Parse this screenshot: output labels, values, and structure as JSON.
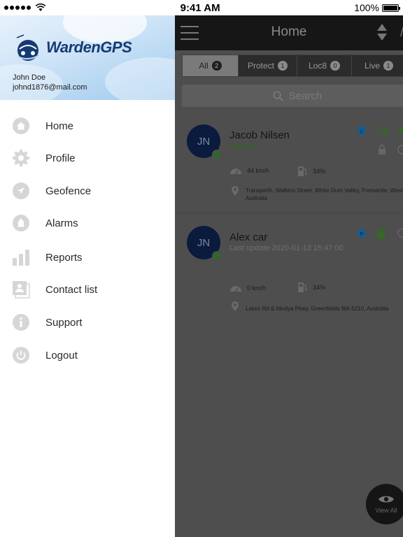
{
  "status_bar": {
    "time": "9:41 AM",
    "battery": "100%"
  },
  "drawer": {
    "brand": "WardenGPS",
    "user_name": "John Doe",
    "user_email": "johnd1876@mail.com",
    "menu": [
      {
        "label": "Home",
        "icon": "home-icon"
      },
      {
        "label": "Profile",
        "icon": "gear-icon"
      },
      {
        "label": "Geofence",
        "icon": "navigation-icon"
      },
      {
        "label": "Alarms",
        "icon": "bell-icon"
      },
      {
        "label": "Reports",
        "icon": "bar-chart-icon"
      },
      {
        "label": "Contact list",
        "icon": "contacts-icon"
      },
      {
        "label": "Support",
        "icon": "info-icon"
      },
      {
        "label": "Logout",
        "icon": "power-icon"
      }
    ]
  },
  "header": {
    "title": "Home"
  },
  "tabs": [
    {
      "label": "All",
      "count": "2"
    },
    {
      "label": "Protect",
      "count": "1"
    },
    {
      "label": "Loc8",
      "count": "0"
    },
    {
      "label": "Live",
      "count": "1"
    }
  ],
  "search": {
    "placeholder": "Search"
  },
  "vehicles": [
    {
      "initials": "JN",
      "name": "Jacob Nilsen",
      "status": "moving",
      "badge": "L",
      "speed": "44 km/h",
      "fuel": "34%",
      "address": "Transperth, Watkins Street, White Gum Valley, Fremantle, Western Australia"
    },
    {
      "initials": "JN",
      "name": "Alex car",
      "status": "Last update 2020-01-13 15:47:00",
      "badge": "P",
      "speed": "0 km/h",
      "fuel": "34%",
      "address": "Lakes Rd & Minilya Pkwy, Greenfields WA 6210, Australia"
    }
  ],
  "view_all": {
    "label": "View All"
  },
  "colors": {
    "brand": "#163a74",
    "avatar": "#0b1b3d",
    "online": "#2a6b27",
    "overlay": "#4e4e4e",
    "badge_blue": "#1a5a8a",
    "signal_green": "#2f6d1d"
  }
}
